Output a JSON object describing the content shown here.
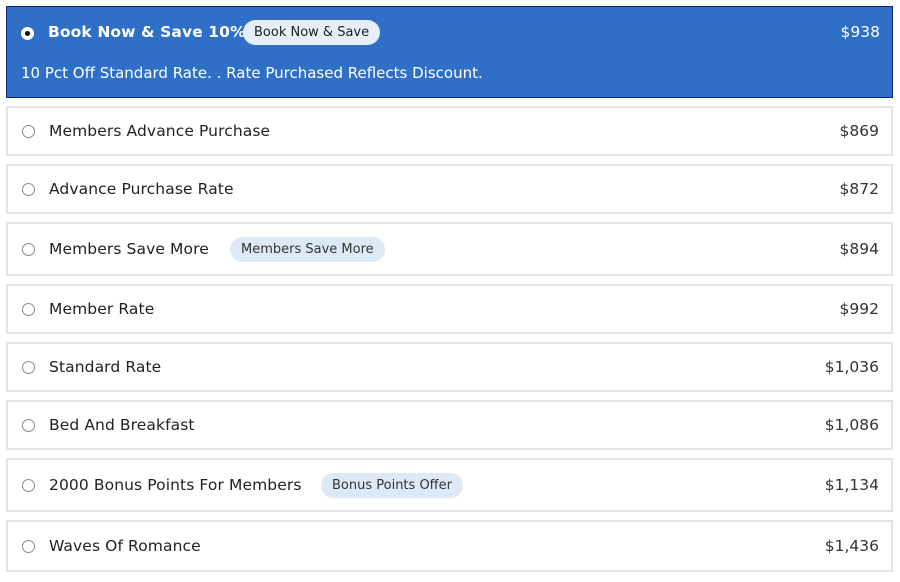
{
  "rates": [
    {
      "name": "Book Now & Save 10%",
      "badge": "Book Now & Save",
      "price": "$938",
      "selected": true,
      "description": "10 Pct Off Standard Rate. . Rate Purchased Reflects Discount."
    },
    {
      "name": "Members Advance Purchase",
      "badge": null,
      "price": "$869",
      "selected": false
    },
    {
      "name": "Advance Purchase Rate",
      "badge": null,
      "price": "$872",
      "selected": false
    },
    {
      "name": "Members Save More",
      "badge": "Members Save More",
      "price": "$894",
      "selected": false
    },
    {
      "name": "Member Rate",
      "badge": null,
      "price": "$992",
      "selected": false
    },
    {
      "name": "Standard Rate",
      "badge": null,
      "price": "$1,036",
      "selected": false
    },
    {
      "name": "Bed And Breakfast",
      "badge": null,
      "price": "$1,086",
      "selected": false
    },
    {
      "name": "2000 Bonus Points For Members",
      "badge": "Bonus Points Offer",
      "price": "$1,134",
      "selected": false
    },
    {
      "name": "Waves Of Romance",
      "badge": null,
      "price": "$1,436",
      "selected": false
    }
  ],
  "colors": {
    "selected_bg": "#2f6fc6",
    "badge_bg": "#dde9f7"
  }
}
